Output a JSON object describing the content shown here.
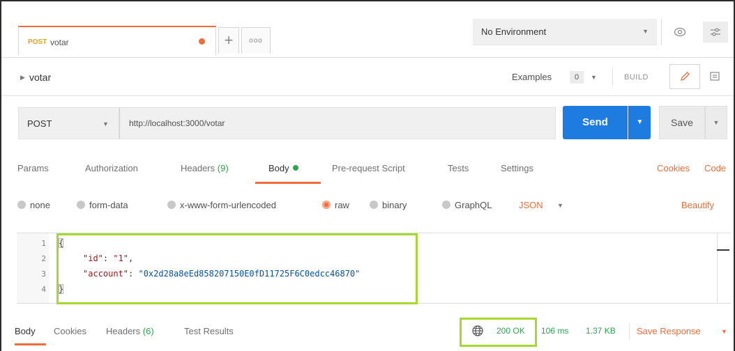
{
  "tabs": {
    "active_tab": {
      "method": "POST",
      "name": "votar"
    },
    "new_tab_symbol": "+",
    "options_symbol": "ooo"
  },
  "environment": {
    "selected": "No Environment",
    "caret": "▼"
  },
  "request": {
    "name": "votar",
    "examples_label": "Examples",
    "examples_count": "0",
    "build_label": "BUILD",
    "method": "POST",
    "url": "http://localhost:3000/votar",
    "send_label": "Send",
    "save_label": "Save"
  },
  "request_tabs": {
    "params": "Params",
    "authorization": "Authorization",
    "headers": "Headers",
    "headers_count": "(9)",
    "body": "Body",
    "pre_request_script": "Pre-request Script",
    "tests": "Tests",
    "settings": "Settings",
    "cookies": "Cookies",
    "code": "Code",
    "active": "Body"
  },
  "body_types": {
    "none": "none",
    "form_data": "form-data",
    "x_www_form_urlencoded": "x-www-form-urlencoded",
    "raw": "raw",
    "binary": "binary",
    "graphql": "GraphQL",
    "selected": "raw",
    "format": "JSON",
    "beautify": "Beautify"
  },
  "editor": {
    "line_numbers": [
      "1",
      "2",
      "3",
      "4"
    ],
    "lines": {
      "l1": "{",
      "l2_key": "\"id\"",
      "l2_sep": ": ",
      "l2_val": "\"1\"",
      "l2_end": ",",
      "l3_key": "\"account\"",
      "l3_sep": ": ",
      "l3_val": "\"0x2d28a8eEd858207150E0fD11725F6C0edcc46870\"",
      "l4": "}"
    }
  },
  "response": {
    "tabs": {
      "body": "Body",
      "cookies": "Cookies",
      "headers": "Headers",
      "headers_count": "(6)",
      "test_results": "Test Results"
    },
    "status": "200 OK",
    "time": "106 ms",
    "size": "1.37 KB",
    "save_response": "Save Response",
    "status_color": "#2ea44f"
  },
  "colors": {
    "accent": "#f26b3a",
    "send_button": "#1e7be0",
    "highlight_box": "#a6d82d",
    "method_post": "#e8a415"
  }
}
